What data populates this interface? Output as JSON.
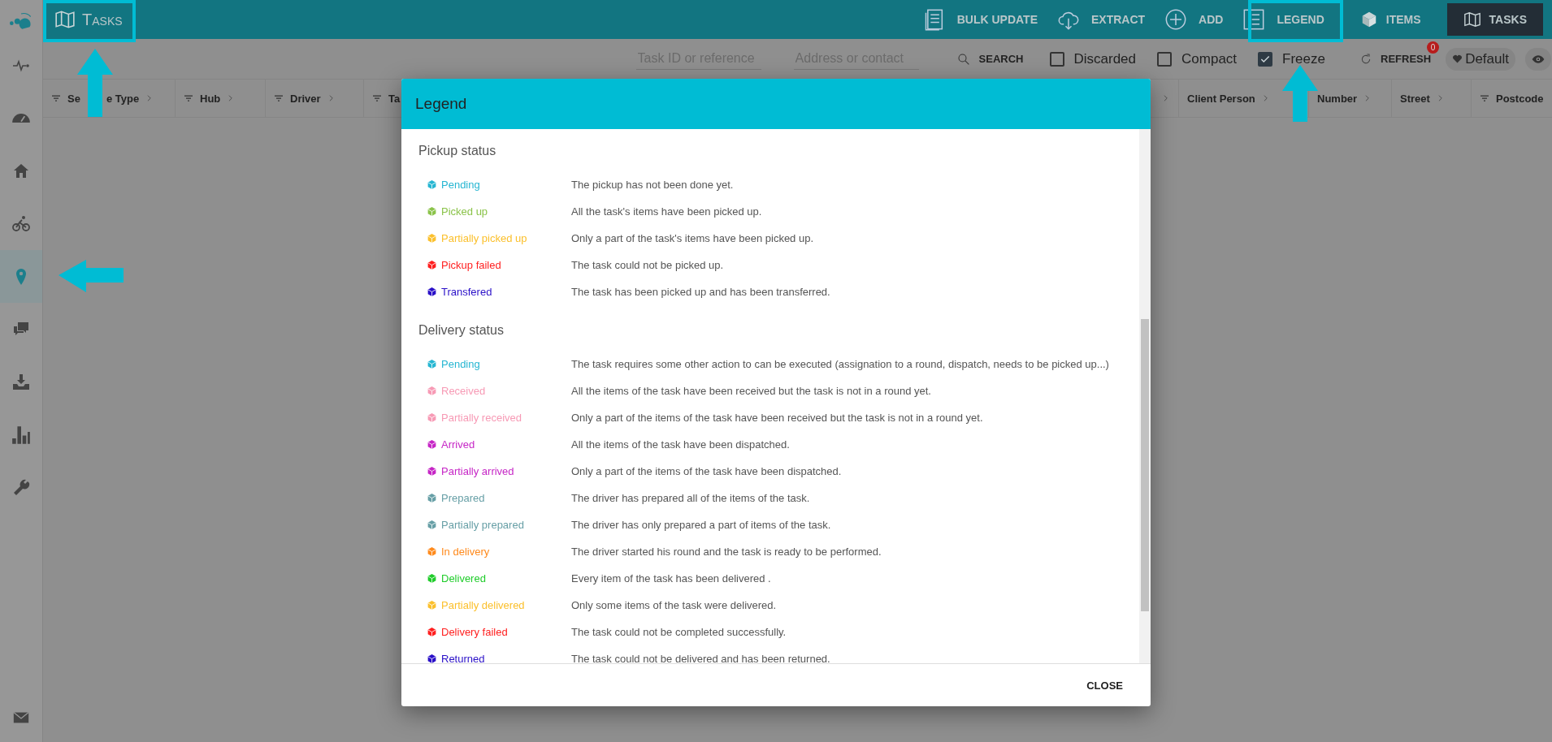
{
  "app_bar": {
    "title": "Tasks",
    "actions": [
      {
        "kind": "document",
        "label": "BULK UPDATE"
      },
      {
        "kind": "cloud",
        "label": "EXTRACT"
      },
      {
        "kind": "plus",
        "label": "ADD"
      },
      {
        "kind": "list",
        "label": "LEGEND"
      }
    ],
    "view_tabs": [
      {
        "kind": "cube",
        "label": "ITEMS",
        "selected": false
      },
      {
        "kind": "map",
        "label": "TASKS",
        "selected": true
      }
    ]
  },
  "sidebar": {
    "items": [
      {
        "kind": "pulse",
        "selected": false
      },
      {
        "kind": "gauge",
        "selected": false
      },
      {
        "kind": "home",
        "selected": false
      },
      {
        "kind": "bike",
        "selected": false
      },
      {
        "kind": "pin",
        "selected": true
      },
      {
        "kind": "chat",
        "selected": false
      },
      {
        "kind": "download",
        "selected": false
      },
      {
        "kind": "chart",
        "selected": false
      },
      {
        "kind": "wrench",
        "selected": false
      }
    ],
    "footer_item": {
      "kind": "mail"
    }
  },
  "toolbar": {
    "fields": [
      {
        "placeholder": "Task ID or reference"
      },
      {
        "placeholder": "Address or contact"
      }
    ],
    "search": "SEARCH",
    "checkboxes": [
      {
        "label": "Discarded",
        "checked": false
      },
      {
        "label": "Compact",
        "checked": false
      },
      {
        "label": "Freeze",
        "checked": true
      }
    ],
    "refresh": "REFRESH",
    "refresh_badge": "0",
    "preset": "Default"
  },
  "table": {
    "columns": [
      {
        "label": "Se",
        "label_continued": "e Type",
        "filterable": true
      },
      {
        "label": "Hub",
        "filterable": true
      },
      {
        "label": "Driver",
        "filterable": true
      },
      {
        "label": "Ta",
        "filterable": true
      },
      {
        "label": "Client Person",
        "filterable": false
      },
      {
        "label": "Number",
        "filterable": false
      },
      {
        "label": "Street",
        "filterable": false
      },
      {
        "label": "Postcode",
        "filterable": true
      }
    ]
  },
  "legend_dialog": {
    "title": "Legend",
    "sections": [
      {
        "title": "Pickup status",
        "items": [
          {
            "label": "Pending",
            "description": "The pickup has not been done yet.",
            "color": "#26b6d2"
          },
          {
            "label": "Picked up",
            "description": "All the task's items have been picked up.",
            "color": "#8bc34a"
          },
          {
            "label": "Partially picked up",
            "description": "Only a part of the task's items have been picked up.",
            "color": "#fbc02d"
          },
          {
            "label": "Pickup failed",
            "description": "The task could not be picked up.",
            "color": "#ff1f1f"
          },
          {
            "label": "Transfered",
            "description": "The task has been picked up and has been transferred.",
            "color": "#2a10c8"
          }
        ]
      },
      {
        "title": "Delivery status",
        "items": [
          {
            "label": "Pending",
            "description": "The task requires some other action to can be executed (assignation to a round, dispatch, needs to be picked up...)",
            "color": "#26b6d2"
          },
          {
            "label": "Received",
            "description": "All the items of the task have been received but the task is not in a round yet.",
            "color": "#f79ab5"
          },
          {
            "label": "Partially received",
            "description": "Only a part of the items of the task have been received but the task is not in a round yet.",
            "color": "#f79ab5"
          },
          {
            "label": "Arrived",
            "description": "All the items of the task have been dispatched.",
            "color": "#c626c6"
          },
          {
            "label": "Partially arrived",
            "description": "Only a part of the items of the task have been dispatched.",
            "color": "#c626c6"
          },
          {
            "label": "Prepared",
            "description": "The driver has prepared all of the items of the task.",
            "color": "#679fa6"
          },
          {
            "label": "Partially prepared",
            "description": "The driver has only prepared a part of items of the task.",
            "color": "#679fa6"
          },
          {
            "label": "In delivery",
            "description": "The driver started his round and the task is ready to be performed.",
            "color": "#ff8a1c"
          },
          {
            "label": "Delivered",
            "description": "Every item of the task has been delivered .",
            "color": "#1fcc2a"
          },
          {
            "label": "Partially delivered",
            "description": "Only some items of the task were delivered.",
            "color": "#fbc02d"
          },
          {
            "label": "Delivery failed",
            "description": "The task could not be completed successfully.",
            "color": "#ff1f1f"
          },
          {
            "label": "Returned",
            "description": "The task could not be delivered and has been returned.",
            "color": "#2a10c8"
          }
        ]
      }
    ],
    "close": "CLOSE"
  }
}
